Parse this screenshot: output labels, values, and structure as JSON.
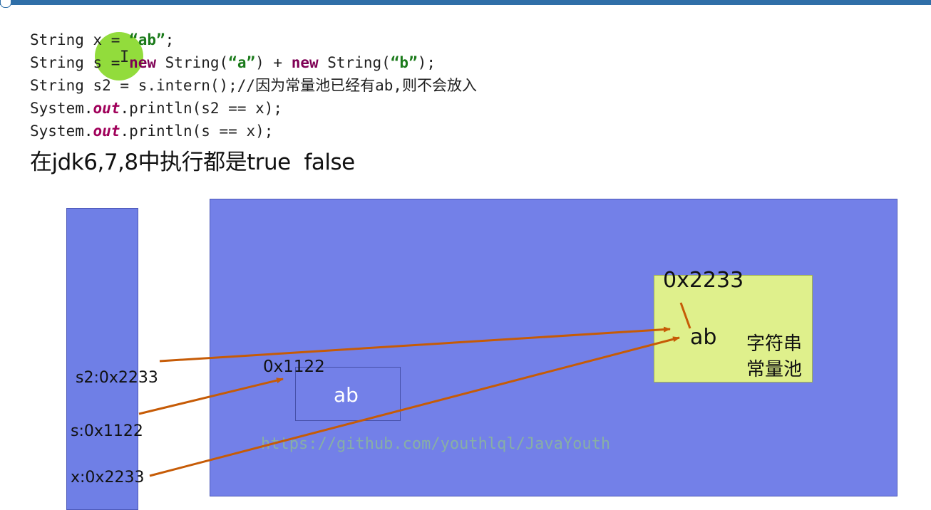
{
  "code": {
    "line1": {
      "a": "String x = ",
      "b": "“ab”",
      "c": ";"
    },
    "line2": {
      "a": "String s = ",
      "b": "new",
      "c": " String(",
      "d": "“a”",
      "e": ") + ",
      "f": "new",
      "g": " String(",
      "h": "“b”",
      "i": ");"
    },
    "line3": {
      "a": "String s2 = s.intern();//因为常量池已经有ab,则不会放入"
    },
    "line4": {
      "a": "System.",
      "b": "out",
      "c": ".println(s2 == x);"
    },
    "line5": {
      "a": "System.",
      "b": "out",
      "c": ".println(s == x);"
    }
  },
  "result_text": "在jdk6,7,8中执行都是true  false",
  "stack": {
    "s2_label": "s2:0x2233",
    "s_label": "s:0x1122",
    "x_label": "x:0x2233"
  },
  "heap": {
    "object_address": "0x1122",
    "object_value": "ab",
    "pool_address": "0x2233",
    "pool_value": "ab",
    "pool_title_line1": "字符串",
    "pool_title_line2": "常量池"
  },
  "watermark": "https://github.com/youthlql/JavaYouth",
  "icons": {
    "cursor": "ibeam-cursor-icon"
  },
  "colors": {
    "stack_fill": "#6f7fe6",
    "heap_fill": "#7380e8",
    "pool_fill": "#dff08c",
    "arrow": "#c65b06",
    "keyword": "#7f0055",
    "string_literal": "#1a7a1a",
    "cursor_highlight": "#7fd61a"
  }
}
